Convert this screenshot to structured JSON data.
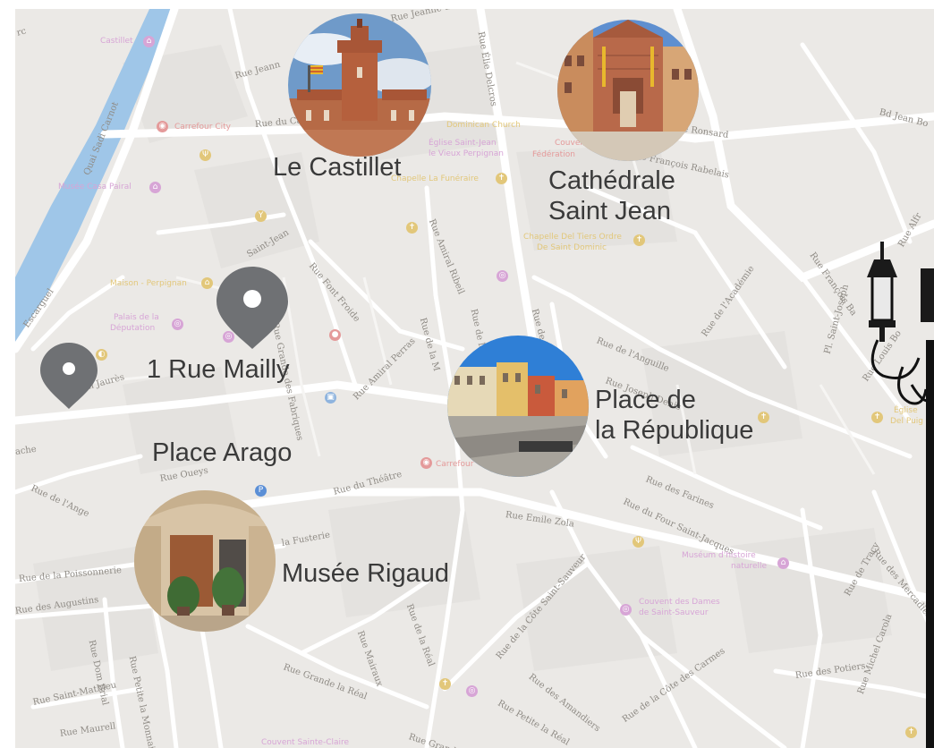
{
  "places": {
    "castillet": "Le Castillet",
    "cathedrale": "Cathédrale\nSaint Jean",
    "rue_mailly": "1 Rue Mailly",
    "republique": "Place de\nla République",
    "arago": "Place Arago",
    "rigaud": "Musée Rigaud"
  },
  "pois": {
    "castillet_small": "Castillet",
    "carrefour_city": "Carrefour City",
    "musee_casa_pairal": "Musée Casa Pairal",
    "dominican_church": "Dominican Church",
    "eglise_saint_jean": "Église Saint-Jean",
    "vieux_perpignan": "le Vieux Perpignan",
    "chapelle_funeraire": "Chapelle La Funéraire",
    "couvent": "Couvent",
    "federation": "Fédération",
    "chapelle_tiers_ordre": "Chapelle Del Tiers Ordre",
    "de_saint_dominic": "De Saint Dominic",
    "maison_perpignan": "Maison - Perpignan",
    "palais_de_la": "Palais de la",
    "deputation": "Députation",
    "carrefour": "Carrefour",
    "museum_histoire": "Muséum d'histoire",
    "naturelle": "naturelle",
    "couvent_dames": "Couvent des Dames",
    "de_saint_sauveur": "de Saint-Sauveur",
    "couvent_sainte_claire": "Couvent Sainte-Claire",
    "eglise_right": "Église",
    "del_puig": "Del Puig"
  },
  "streets": [
    "rc",
    "Rue Jeann",
    "Rue du Ca",
    "Rue Élie Delcros",
    "Quai Sadi Carnot",
    "Rue Jeanne d'Arc",
    "e François Rabelais",
    "de Ronsard",
    "Bd Jean Bo",
    "Rue Amiral Ribeil",
    "Rue Font Froide",
    "Saint-Jean",
    "Rue de la Manche",
    "Rue de l'Anguille",
    "Rue de l'Académie",
    "Rue Joseph Denis",
    "Rue François Ba",
    "Pl. Saint-Joseph",
    "Rue Louis Bo",
    "Rue Alfr",
    "Escarguel",
    "ean Jaurès",
    "Rue Amiral Perras",
    "Rue de la M",
    "Rue de la Barre",
    "Rue Grande des Fabriques",
    "Rue Duchalmeau",
    "Rue Chanzy",
    "Rue des Farines",
    "Rue du Four Saint-Jacques",
    "Rue du Théâtre",
    "Rue Emile Zola",
    "Rue Oueys",
    "la Fusterie",
    "Rue de la Poissonnerie",
    "Rue des Augustins",
    "Rue Dom Brial",
    "Rue Petite la Monnaie",
    "Rue Rolle",
    "Rue Saint-Mathieu",
    "Rue Maurell",
    "Rue Bressans",
    "Rue Mairaux",
    "Rue de la Réal",
    "Rue Grande la Réal",
    "Rue de la Côte Saint-Sauveur",
    "Rue des Amandiers",
    "Rue Petite la Réal",
    "Rue de la Côte des Carmes",
    "Rue des Potiers",
    "Rue de Tracy",
    "Rue des Mercadiers",
    "Rue Michel Carola",
    "Rue des C",
    "Rue de l'Ange",
    "ache",
    "Rue Grande"
  ]
}
